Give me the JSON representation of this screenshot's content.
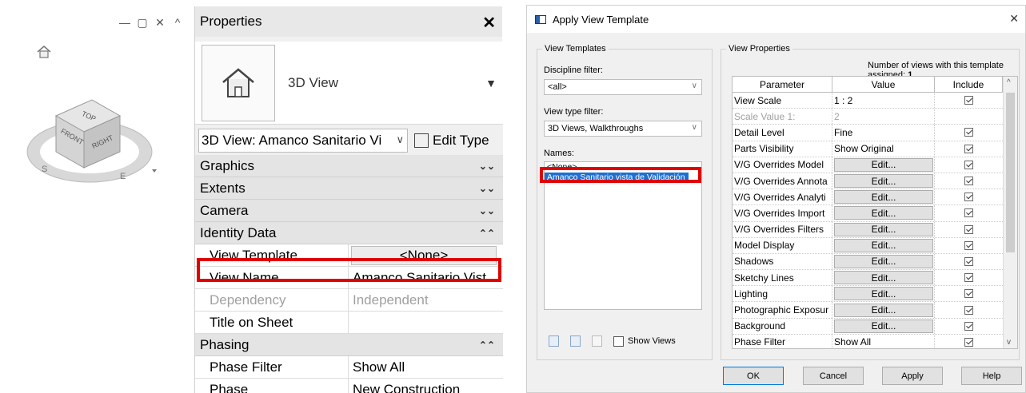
{
  "viewport": {
    "controls": [
      "—",
      "▢",
      "✕",
      "^"
    ],
    "cube_faces": {
      "top": "TOP",
      "front": "FRONT",
      "right": "RIGHT"
    },
    "compass": {
      "south": "S",
      "east": "E"
    }
  },
  "properties": {
    "title": "Properties",
    "close": "✕",
    "type_name": "3D View",
    "instance_selector": "3D View: Amanco Sanitario Vi",
    "edit_type": "Edit Type",
    "sections": {
      "graphics": "Graphics",
      "extents": "Extents",
      "camera": "Camera",
      "identity": "Identity Data",
      "phasing": "Phasing"
    },
    "rows": {
      "view_template": {
        "label": "View Template",
        "value": "<None>"
      },
      "view_name": {
        "label": "View Name",
        "value": "Amanco Sanitario Vist..."
      },
      "dependency": {
        "label": "Dependency",
        "value": "Independent"
      },
      "title_on_sheet": {
        "label": "Title on Sheet",
        "value": ""
      },
      "phase_filter": {
        "label": "Phase Filter",
        "value": "Show All"
      },
      "phase": {
        "label": "Phase",
        "value": "New Construction"
      }
    }
  },
  "dialog": {
    "title": "Apply View Template",
    "close": "✕",
    "view_templates_group": "View Templates",
    "discipline_label": "Discipline filter:",
    "discipline_value": "<all>",
    "viewtype_label": "View type filter:",
    "viewtype_value": "3D Views, Walkthroughs",
    "names_label": "Names:",
    "names": [
      "<None>",
      "Amanco Sanitario vista de Validación"
    ],
    "show_views": "Show Views",
    "view_properties_group": "View Properties",
    "assigned_label": "Number of views with this template assigned:",
    "assigned_count": "1",
    "columns": [
      "Parameter",
      "Value",
      "Include"
    ],
    "rows": [
      {
        "param": "View Scale",
        "value": "1 : 2",
        "button": false,
        "disabled": false,
        "include": true
      },
      {
        "param": "Scale Value   1:",
        "value": "2",
        "button": false,
        "disabled": true,
        "include": false
      },
      {
        "param": "Detail Level",
        "value": "Fine",
        "button": false,
        "disabled": false,
        "include": true
      },
      {
        "param": "Parts Visibility",
        "value": "Show Original",
        "button": false,
        "disabled": false,
        "include": true
      },
      {
        "param": "V/G Overrides Model",
        "value": "Edit...",
        "button": true,
        "disabled": false,
        "include": true
      },
      {
        "param": "V/G Overrides Annota",
        "value": "Edit...",
        "button": true,
        "disabled": false,
        "include": true
      },
      {
        "param": "V/G Overrides Analyti",
        "value": "Edit...",
        "button": true,
        "disabled": false,
        "include": true
      },
      {
        "param": "V/G Overrides Import",
        "value": "Edit...",
        "button": true,
        "disabled": false,
        "include": true
      },
      {
        "param": "V/G Overrides Filters",
        "value": "Edit...",
        "button": true,
        "disabled": false,
        "include": true
      },
      {
        "param": "Model Display",
        "value": "Edit...",
        "button": true,
        "disabled": false,
        "include": true
      },
      {
        "param": "Shadows",
        "value": "Edit...",
        "button": true,
        "disabled": false,
        "include": true
      },
      {
        "param": "Sketchy Lines",
        "value": "Edit...",
        "button": true,
        "disabled": false,
        "include": true
      },
      {
        "param": "Lighting",
        "value": "Edit...",
        "button": true,
        "disabled": false,
        "include": true
      },
      {
        "param": "Photographic Exposur",
        "value": "Edit...",
        "button": true,
        "disabled": false,
        "include": true
      },
      {
        "param": "Background",
        "value": "Edit...",
        "button": true,
        "disabled": false,
        "include": true
      },
      {
        "param": "Phase Filter",
        "value": "Show All",
        "button": false,
        "disabled": false,
        "include": true
      }
    ],
    "buttons": {
      "ok": "OK",
      "cancel": "Cancel",
      "apply": "Apply",
      "help": "Help"
    }
  }
}
